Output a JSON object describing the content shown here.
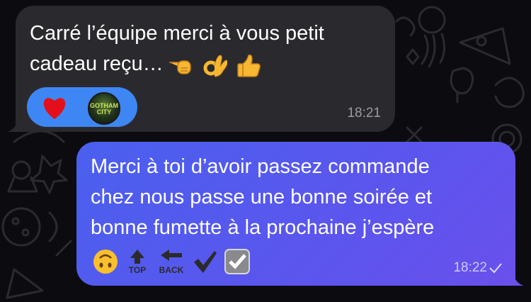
{
  "messages": [
    {
      "direction": "incoming",
      "lines": [
        "Carré l’équipe merci à vous petit",
        "cadeau reçu…"
      ],
      "emojis": [
        "pointing-hand-emoji",
        "ok-hand-emoji",
        "thumbs-up-emoji"
      ],
      "reactions": [
        "heart-reaction",
        "gotham-city-avatar"
      ],
      "reaction_avatar_text": "GOTHAM CITY",
      "time": "18:21"
    },
    {
      "direction": "outgoing",
      "lines": [
        "Merci à toi d’avoir passez commande",
        "chez nous passe une bonne soirée et",
        "bonne fumette à la prochaine j’espère"
      ],
      "emojis": [
        "upside-down-face-emoji",
        "top-arrow-emoji",
        "back-arrow-emoji",
        "check-mark-emoji",
        "check-box-emoji"
      ],
      "top_label": "TOP",
      "back_label": "BACK",
      "time": "18:22",
      "status": "sent"
    }
  ],
  "colors": {
    "background": "#0c0c10",
    "incoming_bubble": "#2a2a2e",
    "outgoing_bubble": "#5258ee",
    "reaction_pill": "#3f86f5"
  }
}
